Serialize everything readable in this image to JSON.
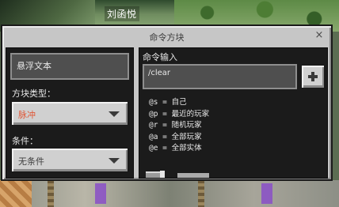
{
  "world": {
    "player_name": "刘函悦"
  },
  "dialog": {
    "title": "命令方块",
    "close_glyph": "×"
  },
  "left": {
    "hover_text": {
      "value": "悬浮文本"
    },
    "block_type": {
      "label": "方块类型：",
      "value": "脉冲",
      "value_color": "#e05a3a"
    },
    "condition": {
      "label": "条件：",
      "value": "无条件"
    }
  },
  "right": {
    "command_label": "命令输入",
    "command_input": {
      "value": "/clear"
    },
    "add_button_glyph": "+",
    "hints": [
      "@s = 自己",
      "@p = 最近的玩家",
      "@r = 随机玩家",
      "@a = 全部玩家",
      "@e = 全部实体"
    ]
  }
}
